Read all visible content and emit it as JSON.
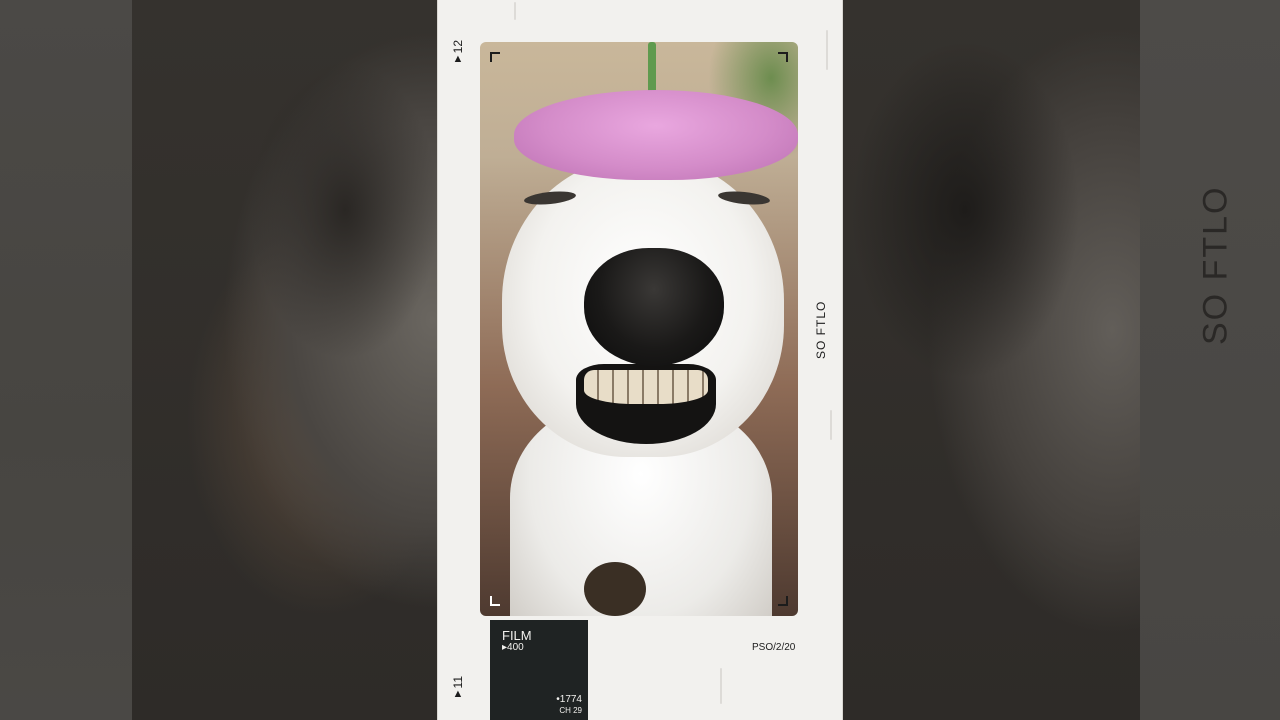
{
  "background": {
    "vertical_text": "SO FTLO"
  },
  "card": {
    "frame_top": {
      "number": "12",
      "marker": "▲"
    },
    "frame_bottom": {
      "number": "11",
      "marker": "▲"
    },
    "side_label": "SO FTLO",
    "film": {
      "title": "FILM",
      "iso": "▸400",
      "code": "•1774",
      "channel": "CH 29"
    },
    "roll_code": "PSO/2/20"
  },
  "colors": {
    "card_bg": "#f2f1ee",
    "film_block_bg": "#1f2323",
    "flower_pink": "#d48cc9"
  }
}
